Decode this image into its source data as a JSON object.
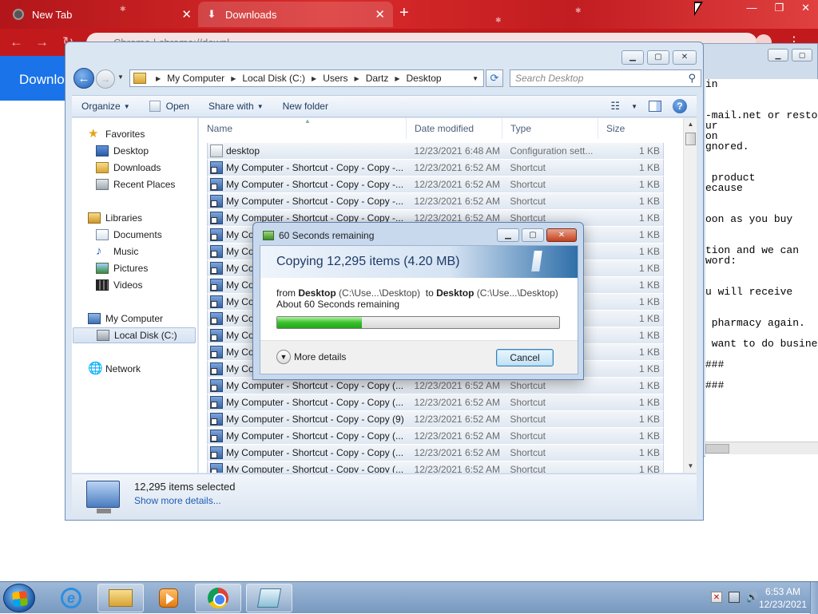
{
  "chrome": {
    "tabs": [
      {
        "title": "New Tab",
        "icon": "chrome-newtab-icon"
      },
      {
        "title": "Downloads",
        "icon": "download-icon"
      }
    ],
    "omnibox_text": "Chrome  |  chrome://downl...",
    "page_banner": "Downlo"
  },
  "notepad": {
    "lines": [
      "in",
      "",
      "",
      "-mail.net or resto",
      "ur",
      "on",
      "gnored.",
      "",
      "",
      " product",
      "ecause",
      "",
      "",
      "oon as you buy",
      "",
      "",
      "tion and we can",
      "word:",
      "",
      "",
      "u will receive",
      "",
      "",
      " pharmacy again.",
      "",
      " want to do busine",
      "",
      "###",
      "",
      "###"
    ]
  },
  "explorer": {
    "breadcrumb": [
      "My Computer",
      "Local Disk (C:)",
      "Users",
      "Dartz",
      "Desktop"
    ],
    "search_placeholder": "Search Desktop",
    "commands": {
      "organize": "Organize",
      "open": "Open",
      "share_with": "Share with",
      "new_folder": "New folder"
    },
    "nav": {
      "favorites": "Favorites",
      "favorites_items": [
        "Desktop",
        "Downloads",
        "Recent Places"
      ],
      "libraries": "Libraries",
      "libraries_items": [
        "Documents",
        "Music",
        "Pictures",
        "Videos"
      ],
      "computer": "My Computer",
      "computer_items": [
        "Local Disk (C:)"
      ],
      "network": "Network"
    },
    "columns": {
      "name": "Name",
      "date": "Date modified",
      "type": "Type",
      "size": "Size"
    },
    "files": [
      {
        "name": "desktop",
        "date": "12/23/2021 6:48 AM",
        "type": "Configuration sett...",
        "size": "1 KB",
        "kind": "cfg"
      },
      {
        "name": "My Computer - Shortcut - Copy - Copy -...",
        "date": "12/23/2021 6:52 AM",
        "type": "Shortcut",
        "size": "1 KB",
        "kind": "lnk"
      },
      {
        "name": "My Computer - Shortcut - Copy - Copy -...",
        "date": "12/23/2021 6:52 AM",
        "type": "Shortcut",
        "size": "1 KB",
        "kind": "lnk"
      },
      {
        "name": "My Computer - Shortcut - Copy - Copy -...",
        "date": "12/23/2021 6:52 AM",
        "type": "Shortcut",
        "size": "1 KB",
        "kind": "lnk"
      },
      {
        "name": "My Computer - Shortcut - Copy - Copy -...",
        "date": "12/23/2021 6:52 AM",
        "type": "Shortcut",
        "size": "1 KB",
        "kind": "lnk"
      },
      {
        "name": "My Computer - Shortcut - Copy - Copy -...",
        "date": "12/23/2021 6:52 AM",
        "type": "Shortcut",
        "size": "1 KB",
        "kind": "lnk"
      },
      {
        "name": "My Computer - Shortcut - Copy - Copy -...",
        "date": "12/23/2021 6:52 AM",
        "type": "Shortcut",
        "size": "1 KB",
        "kind": "lnk"
      },
      {
        "name": "My Computer - Shortcut - Copy - Copy -...",
        "date": "12/23/2021 6:52 AM",
        "type": "Shortcut",
        "size": "1 KB",
        "kind": "lnk"
      },
      {
        "name": "My Computer - Shortcut - Copy - Copy -...",
        "date": "12/23/2021 6:52 AM",
        "type": "Shortcut",
        "size": "1 KB",
        "kind": "lnk"
      },
      {
        "name": "My Computer - Shortcut - Copy - Copy -...",
        "date": "12/23/2021 6:52 AM",
        "type": "Shortcut",
        "size": "1 KB",
        "kind": "lnk"
      },
      {
        "name": "My Computer - Shortcut - Copy - Copy -...",
        "date": "12/23/2021 6:52 AM",
        "type": "Shortcut",
        "size": "1 KB",
        "kind": "lnk"
      },
      {
        "name": "My Computer - Shortcut - Copy - Copy -...",
        "date": "12/23/2021 6:52 AM",
        "type": "Shortcut",
        "size": "1 KB",
        "kind": "lnk"
      },
      {
        "name": "My Computer - Shortcut - Copy - Copy -...",
        "date": "12/23/2021 6:52 AM",
        "type": "Shortcut",
        "size": "1 KB",
        "kind": "lnk"
      },
      {
        "name": "My Computer - Shortcut - Copy - Copy -...",
        "date": "12/23/2021 6:52 AM",
        "type": "Shortcut",
        "size": "1 KB",
        "kind": "lnk"
      },
      {
        "name": "My Computer - Shortcut - Copy - Copy (...",
        "date": "12/23/2021 6:52 AM",
        "type": "Shortcut",
        "size": "1 KB",
        "kind": "lnk"
      },
      {
        "name": "My Computer - Shortcut - Copy - Copy (...",
        "date": "12/23/2021 6:52 AM",
        "type": "Shortcut",
        "size": "1 KB",
        "kind": "lnk"
      },
      {
        "name": "My Computer - Shortcut - Copy - Copy (9)",
        "date": "12/23/2021 6:52 AM",
        "type": "Shortcut",
        "size": "1 KB",
        "kind": "lnk"
      },
      {
        "name": "My Computer - Shortcut - Copy - Copy (...",
        "date": "12/23/2021 6:52 AM",
        "type": "Shortcut",
        "size": "1 KB",
        "kind": "lnk"
      },
      {
        "name": "My Computer - Shortcut - Copy - Copy (...",
        "date": "12/23/2021 6:52 AM",
        "type": "Shortcut",
        "size": "1 KB",
        "kind": "lnk"
      },
      {
        "name": "My Computer - Shortcut - Copy - Copy (...",
        "date": "12/23/2021 6:52 AM",
        "type": "Shortcut",
        "size": "1 KB",
        "kind": "lnk"
      }
    ],
    "details": {
      "count": "12,295 items selected",
      "link": "Show more details..."
    }
  },
  "copy_dialog": {
    "title": "60 Seconds remaining",
    "heading": "Copying 12,295 items (4.20 MB)",
    "from_label": "from",
    "from_name": "Desktop",
    "from_path": "(C:\\Use...\\Desktop)",
    "to_label": "to",
    "to_name": "Desktop",
    "to_path": "(C:\\Use...\\Desktop)",
    "remaining": "About 60 Seconds remaining",
    "progress_percent": 30,
    "more_details": "More details",
    "cancel": "Cancel"
  },
  "taskbar": {
    "time": "6:53 AM",
    "date": "12/23/2021",
    "apps": [
      "ie-icon",
      "explorer-icon",
      "media-player-icon",
      "chrome-icon",
      "notepad-icon"
    ]
  },
  "colors": {
    "chrome_theme": "#c2191c",
    "progress_green": "#37c12a",
    "link_blue": "#1f5db0",
    "selection_border": "#a9c0de"
  }
}
